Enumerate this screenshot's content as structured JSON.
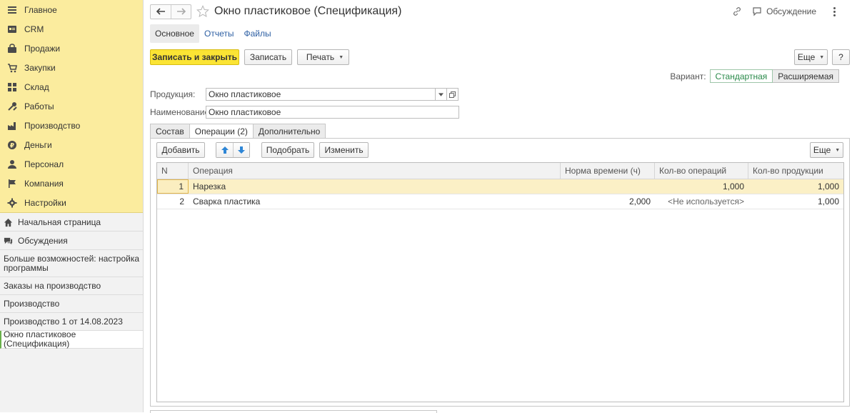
{
  "sidebar": {
    "sections": [
      {
        "label": "Главное",
        "icon": "menu-icon"
      },
      {
        "label": "CRM",
        "icon": "crm-icon"
      },
      {
        "label": "Продажи",
        "icon": "sales-icon"
      },
      {
        "label": "Закупки",
        "icon": "purchases-icon"
      },
      {
        "label": "Склад",
        "icon": "warehouse-icon"
      },
      {
        "label": "Работы",
        "icon": "tools-icon"
      },
      {
        "label": "Производство",
        "icon": "factory-icon"
      },
      {
        "label": "Деньги",
        "icon": "money-icon"
      },
      {
        "label": "Персонал",
        "icon": "person-icon"
      },
      {
        "label": "Компания",
        "icon": "flag-icon"
      },
      {
        "label": "Настройки",
        "icon": "gear-icon"
      }
    ],
    "home_label": "Начальная страница",
    "discussions_label": "Обсуждения",
    "history": [
      "Больше возможностей: настройка программы",
      "Заказы на производство",
      "Производство",
      "Производство 1 от 14.08.2023",
      "Окно пластиковое (Спецификация)"
    ]
  },
  "header": {
    "title": "Окно пластиковое (Спецификация)",
    "discuss_label": "Обсуждение"
  },
  "page_tabs": [
    "Основное",
    "Отчеты",
    "Файлы"
  ],
  "toolbar": {
    "save_close": "Записать и закрыть",
    "save": "Записать",
    "print": "Печать",
    "more": "Еще",
    "help": "?"
  },
  "variant": {
    "label": "Вариант:",
    "standard": "Стандартная",
    "extended": "Расширяемая"
  },
  "fields": {
    "product_label": "Продукция:",
    "product_value": "Окно пластиковое",
    "name_label": "Наименование:",
    "name_value": "Окно пластиковое"
  },
  "form_tabs": [
    "Состав",
    "Операции (2)",
    "Дополнительно"
  ],
  "ops_toolbar": {
    "add": "Добавить",
    "pick": "Подобрать",
    "edit": "Изменить",
    "more": "Еще"
  },
  "table": {
    "columns": [
      "N",
      "Операция",
      "Норма времени (ч)",
      "Кол-во операций",
      "Кол-во продукции"
    ],
    "rows": [
      {
        "n": "1",
        "op": "Нарезка",
        "norm": "",
        "count": "1,000",
        "prod": "1,000"
      },
      {
        "n": "2",
        "op": "Сварка пластика",
        "norm": "2,000",
        "count": "<Не используется>",
        "prod": "1,000"
      }
    ]
  }
}
